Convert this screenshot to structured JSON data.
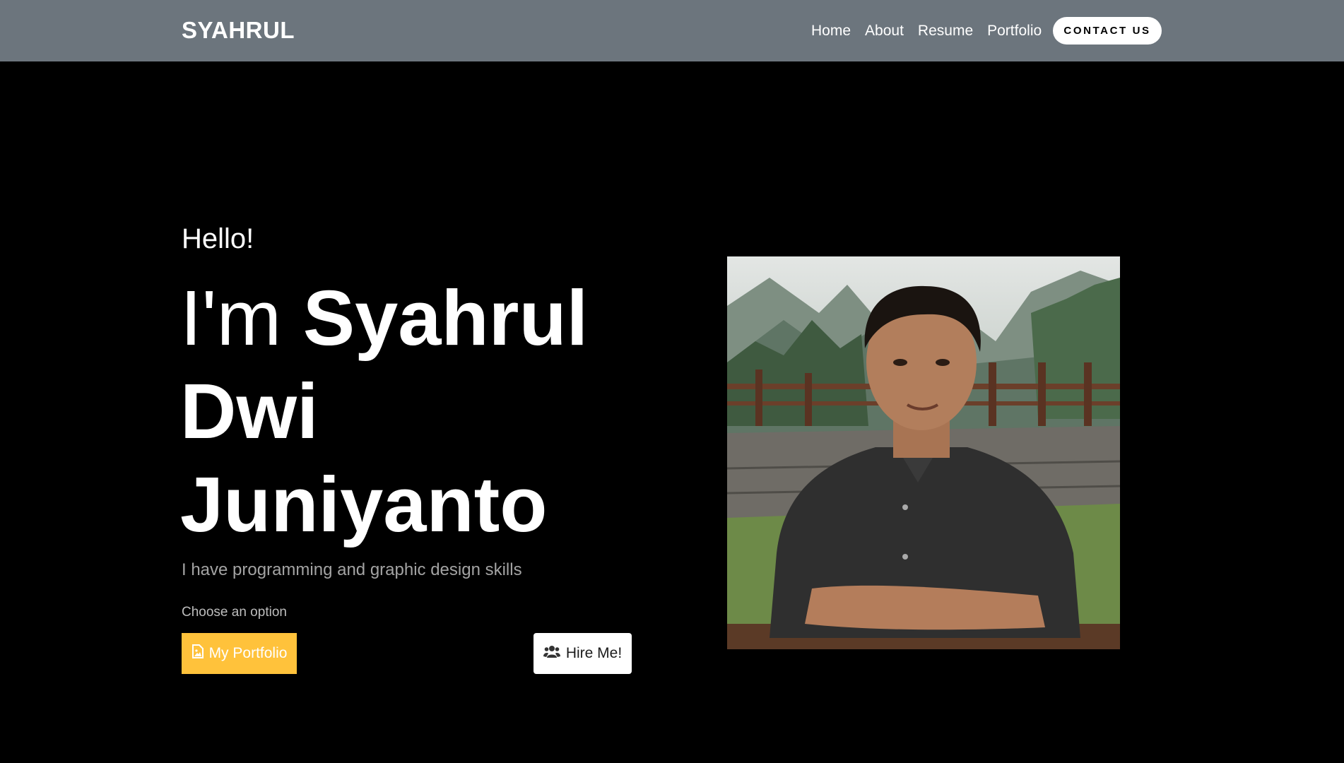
{
  "navbar": {
    "brand": "SYAHRUL",
    "links": [
      "Home",
      "About",
      "Resume",
      "Portfolio"
    ],
    "contact_label": "CONTACT US"
  },
  "hero": {
    "greeting": "Hello!",
    "intro": "I'm",
    "name": "Syahrul Dwi Juniyanto",
    "subtitle": "I have programming and graphic design skills",
    "choose_label": "Choose an option",
    "portfolio_button": "My Portfolio",
    "hire_button": "Hire Me!"
  },
  "icons": {
    "portfolio_button_icon": "image-file-icon",
    "hire_button_icon": "users-icon"
  },
  "colors": {
    "navbar_bg": "#6c757d",
    "page_bg": "#000000",
    "accent": "#ffc23b",
    "subtitle_text": "#a3a3a3"
  }
}
